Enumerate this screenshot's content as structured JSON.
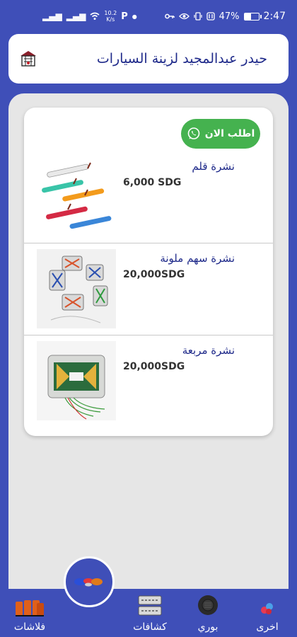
{
  "status_bar": {
    "signal_1": "▂▄▆",
    "signal_2": "▂▄▆",
    "speed_value": "10.2",
    "speed_unit": "K/s",
    "p_icon": "P",
    "battery": "47%",
    "battery_level": 0.47,
    "time": "2:47"
  },
  "header": {
    "title": "حيدر عبدالمجيد لزينة السيارات",
    "logo_icon": "store-logo-icon"
  },
  "order_button": {
    "label": "اطلب الان",
    "icon": "whatsapp-icon"
  },
  "products": [
    {
      "name": "نشرة قلم",
      "price": "6,000 SDG"
    },
    {
      "name": "نشرة سهم ملونة",
      "price": "20,000SDG"
    },
    {
      "name": "نشرة مربعة",
      "price": "20,000SDG"
    }
  ],
  "bottom_nav": {
    "items": [
      {
        "label": "اخرى",
        "icon": "other-icon"
      },
      {
        "label": "بوري",
        "icon": "horn-icon"
      },
      {
        "label": "كشافات",
        "icon": "spotlight-icon"
      },
      {
        "label": "فلاشات",
        "icon": "flasher-icon"
      }
    ],
    "center_icon": "lights-fab-icon"
  },
  "colors": {
    "primary": "#3f4fb8",
    "title_blue": "#1f2a8a",
    "whatsapp_green": "#45b24f",
    "panel_bg": "#e6e6e6"
  }
}
